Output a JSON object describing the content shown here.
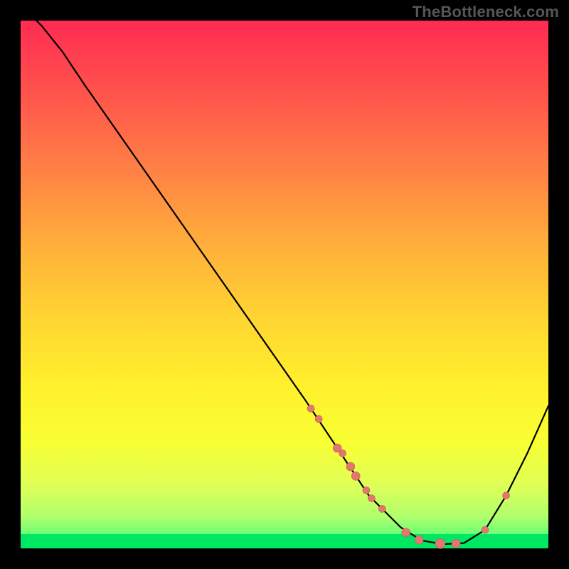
{
  "watermark": "TheBottleneck.com",
  "colors": {
    "dot_fill": "#e2776f",
    "dot_stroke": "#c45a53",
    "curve": "#000000"
  },
  "chart_data": {
    "type": "line",
    "title": "",
    "xlabel": "",
    "ylabel": "",
    "xlim": [
      0,
      100
    ],
    "ylim": [
      0,
      100
    ],
    "curve": [
      {
        "x": 0,
        "y": 103
      },
      {
        "x": 4,
        "y": 99
      },
      {
        "x": 8,
        "y": 94
      },
      {
        "x": 12,
        "y": 88
      },
      {
        "x": 54,
        "y": 28
      },
      {
        "x": 60,
        "y": 19
      },
      {
        "x": 66,
        "y": 10
      },
      {
        "x": 72,
        "y": 4
      },
      {
        "x": 76,
        "y": 1.5
      },
      {
        "x": 80,
        "y": 0.8
      },
      {
        "x": 84,
        "y": 1.0
      },
      {
        "x": 88,
        "y": 3.5
      },
      {
        "x": 92,
        "y": 10
      },
      {
        "x": 96,
        "y": 18
      },
      {
        "x": 100,
        "y": 27
      }
    ],
    "dots": [
      {
        "x": 55.0,
        "y": 26.5,
        "r": 5
      },
      {
        "x": 56.5,
        "y": 24.5,
        "r": 5
      },
      {
        "x": 60.0,
        "y": 19.0,
        "r": 6
      },
      {
        "x": 61.0,
        "y": 18.0,
        "r": 5
      },
      {
        "x": 62.5,
        "y": 15.5,
        "r": 6
      },
      {
        "x": 63.5,
        "y": 13.7,
        "r": 6
      },
      {
        "x": 65.5,
        "y": 11.0,
        "r": 5
      },
      {
        "x": 66.5,
        "y": 9.5,
        "r": 5
      },
      {
        "x": 68.5,
        "y": 7.5,
        "r": 5
      },
      {
        "x": 73.0,
        "y": 3.0,
        "r": 6
      },
      {
        "x": 75.5,
        "y": 1.6,
        "r": 6
      },
      {
        "x": 79.5,
        "y": 0.9,
        "r": 7
      },
      {
        "x": 82.5,
        "y": 0.9,
        "r": 6
      },
      {
        "x": 88.0,
        "y": 3.5,
        "r": 5
      },
      {
        "x": 92.0,
        "y": 10.0,
        "r": 5
      }
    ]
  }
}
